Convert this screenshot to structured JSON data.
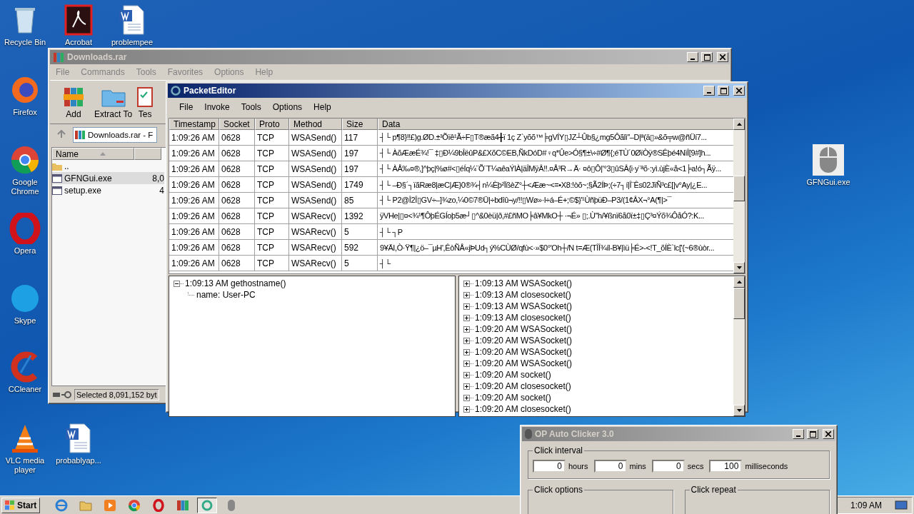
{
  "desktop_icons": [
    {
      "label": "Recycle Bin",
      "kind": "recycle"
    },
    {
      "label": "Acrobat",
      "kind": "pdf"
    },
    {
      "label": "problempee",
      "kind": "word"
    },
    {
      "label": "Firefox",
      "kind": "firefox"
    },
    {
      "label": "Google Chrome",
      "kind": "chrome"
    },
    {
      "label": "Opera",
      "kind": "opera"
    },
    {
      "label": "Skype",
      "kind": "skype"
    },
    {
      "label": "CCleaner",
      "kind": "ccleaner"
    },
    {
      "label": "VLC media player",
      "kind": "vlc"
    },
    {
      "label": "probablyap...",
      "kind": "word"
    },
    {
      "label": "GFNGui.exe",
      "kind": "mouse"
    }
  ],
  "winrar": {
    "title": "Downloads.rar",
    "active": false,
    "menu": [
      "File",
      "Commands",
      "Tools",
      "Favorites",
      "Options",
      "Help"
    ],
    "toolbar": [
      {
        "label": "Add",
        "kind": "add"
      },
      {
        "label": "Extract To",
        "kind": "extract"
      },
      {
        "label": "Tes",
        "kind": "test"
      }
    ],
    "address": "Downloads.rar - F",
    "column": "Name",
    "files": [
      {
        "name": "..",
        "kind": "folder",
        "selected": false
      },
      {
        "name": "GFNGui.exe",
        "size": "8,0",
        "kind": "exe",
        "selected": true
      },
      {
        "name": "setup.exe",
        "size": "4",
        "kind": "exe",
        "selected": false
      }
    ],
    "status": "Selected 8,091,152 byt"
  },
  "packet_editor": {
    "title": "PacketEditor",
    "active": true,
    "menu": [
      "File",
      "Invoke",
      "Tools",
      "Options",
      "Help"
    ],
    "columns": [
      "Timestamp",
      "Socket",
      "Proto",
      "Method",
      "Size",
      "Data"
    ],
    "rows": [
      [
        "1:09:26 AM",
        "0628",
        "TCP",
        "WSASend()",
        "117",
        "┤└     p¶8}‼£)g.ØD.±³Õïê¹Ã÷F▯T®æã4╂ï    1ç  Z`yõõ™╞gVÍY▯JZ┴Ûb§¿mg5Ôãlì''–D|ª(ä▯»&õ╤w@ñÜí7..."
      ],
      [
        "1:09:26 AM",
        "0628",
        "TCP",
        "WSASend()",
        "197",
        "┤└     ÀõÆæÉ¾!¯ ‡▯Ð¼9bÎëûP&£XõC©EB,ÑkDóD#♀q*Ûe>Ó§¶±\\÷#Ø¶{;éTÙ´0ØïÒÿ®SÊþé4NìÎ[9#]h..."
      ],
      [
        "1:09:26 AM",
        "0628",
        "TCP",
        "WSASend()",
        "197",
        "┤└     ÀÅ‰¤®,]^þç|%ø#<▯éÍq¼¨Õ¨T¼aêaÝlÀ|äÎMÿÂ!!.¤Å³R→Ä· ¤ô▯Ô|'°3▯ûSÂ{i·y¨ªõ·:yì.ùjÈ«å<1╞a!ó┐Ãÿ..."
      ],
      [
        "1:09:26 AM",
        "0628",
        "TCP",
        "WSASend()",
        "1749",
        "┤└   –Ð§´┐ïãRæ8|æC|Æ}0®¾┤n¼Èþ²ÏßèZ°┼<Ææ~<=•X8:!òõ~;§Ã2ÍÞ;(÷7┐í|Î¨Ês02JïÑ³c£[|v°Ay|¿E..."
      ],
      [
        "1:09:26 AM",
        "0628",
        "TCP",
        "WSASend()",
        "85",
        "┤└     P2@Î2Î▯GV÷–]¾zo,¼0©7®Ü|÷bdîû¬y/!!▯Wø»·l÷á–É+;©$}'¹ÙñþüÐ–P3/(1¢ÂX¬°A(¶|>¯"
      ],
      [
        "1:09:26 AM",
        "0628",
        "TCP",
        "WSARecv()",
        "1392",
        "ÿVHe|▯¤<¾¹¶ÔþÉGÍoþ5æ┘▯^&0èü|ð,#£ñMO╞â¥MkO┼    ·¬É» ▯;.Ù''h/¥ßnï6å0ï±‡▯Ç³¤Ýõ¾ÔåÓ?:K..."
      ],
      [
        "1:09:26 AM",
        "0628",
        "TCP",
        "WSARecv()",
        "5",
        "┤└   ┐P"
      ],
      [
        "1:09:26 AM",
        "0628",
        "TCP",
        "WSARecv()",
        "592",
        "9¥ÄI,Ò·Ÿ¶|¿ö–¯µH',ÊòÑÅ«jÞUd┐ý%CÙØ/qfù<·»$0°'Oh┼/N t=Æ(TÎÎ¾íl-B¥|ìü╞É>-<!T_õÍÈ`lc['{~6®ùòr..."
      ],
      [
        "1:09:26 AM",
        "0628",
        "TCP",
        "WSARecv()",
        "5",
        "┤└"
      ]
    ],
    "left_tree": [
      {
        "label": "1:09:13 AM gethostname()",
        "expanded": true,
        "children": [
          {
            "label": "name: User-PC"
          }
        ]
      }
    ],
    "right_tree": [
      {
        "label": "1:09:13 AM WSASocket()",
        "expanded": false
      },
      {
        "label": "1:09:13 AM closesocket()",
        "expanded": false
      },
      {
        "label": "1:09:13 AM WSASocket()",
        "expanded": false
      },
      {
        "label": "1:09:13 AM closesocket()",
        "expanded": false
      },
      {
        "label": "1:09:20 AM WSASocket()",
        "expanded": false
      },
      {
        "label": "1:09:20 AM WSASocket()",
        "expanded": false
      },
      {
        "label": "1:09:20 AM WSASocket()",
        "expanded": false
      },
      {
        "label": "1:09:20 AM WSASocket()",
        "expanded": false
      },
      {
        "label": "1:09:20 AM socket()",
        "expanded": false
      },
      {
        "label": "1:09:20 AM closesocket()",
        "expanded": false
      },
      {
        "label": "1:09:20 AM socket()",
        "expanded": false
      },
      {
        "label": "1:09:20 AM closesocket()",
        "expanded": false
      }
    ]
  },
  "auto_clicker": {
    "title": "OP Auto Clicker 3.0",
    "active": false,
    "interval_label": "Click interval",
    "fields": [
      {
        "value": "0",
        "unit": "hours"
      },
      {
        "value": "0",
        "unit": "mins"
      },
      {
        "value": "0",
        "unit": "secs"
      },
      {
        "value": "100",
        "unit": "milliseconds"
      }
    ],
    "options_label": "Click options",
    "repeat_label": "Click repeat"
  },
  "taskbar": {
    "start": "Start",
    "apps": [
      {
        "kind": "ie",
        "active": false
      },
      {
        "kind": "explorer",
        "active": false
      },
      {
        "kind": "media",
        "active": false
      },
      {
        "kind": "chrome",
        "active": false
      },
      {
        "kind": "opera",
        "active": false
      },
      {
        "kind": "winrar",
        "active": false
      },
      {
        "kind": "packet",
        "active": true
      },
      {
        "kind": "mouse",
        "active": false
      }
    ],
    "clock": "1:09 AM"
  }
}
